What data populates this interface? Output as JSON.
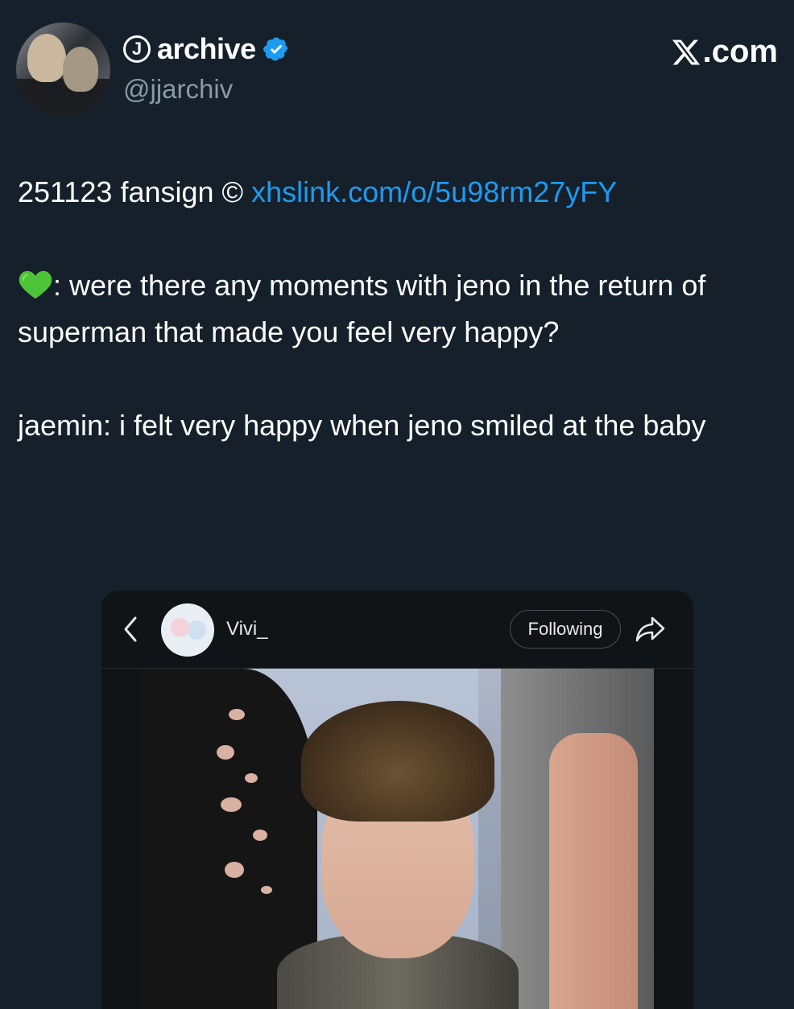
{
  "author": {
    "display_name": "archive",
    "name_prefix_icon": "circled-j-icon",
    "verified_icon": "verified-badge-icon",
    "handle": "@jjarchiv",
    "avatar_icon": "profile-avatar"
  },
  "site": {
    "logo_icon": "x-logo-icon",
    "label": ".com"
  },
  "tweet": {
    "line1_text": "251123 fansign © ",
    "line1_link": "xhslink.com/o/5u98rm27yFY",
    "q_icon": "green-heart-emoji",
    "q_text": ": were there any moments with jeno in the return of superman that made you feel very happy?",
    "a_text": "jaemin: i felt very happy when jeno smiled at the baby"
  },
  "embed": {
    "username": "Vivi_",
    "following_label": "Following",
    "back_icon": "chevron-left-icon",
    "share_icon": "share-arrow-icon"
  },
  "colors": {
    "background": "#15202b",
    "link": "#1d9bf0",
    "verified": "#1d9bf0",
    "secondary_text": "#8b98a5"
  }
}
